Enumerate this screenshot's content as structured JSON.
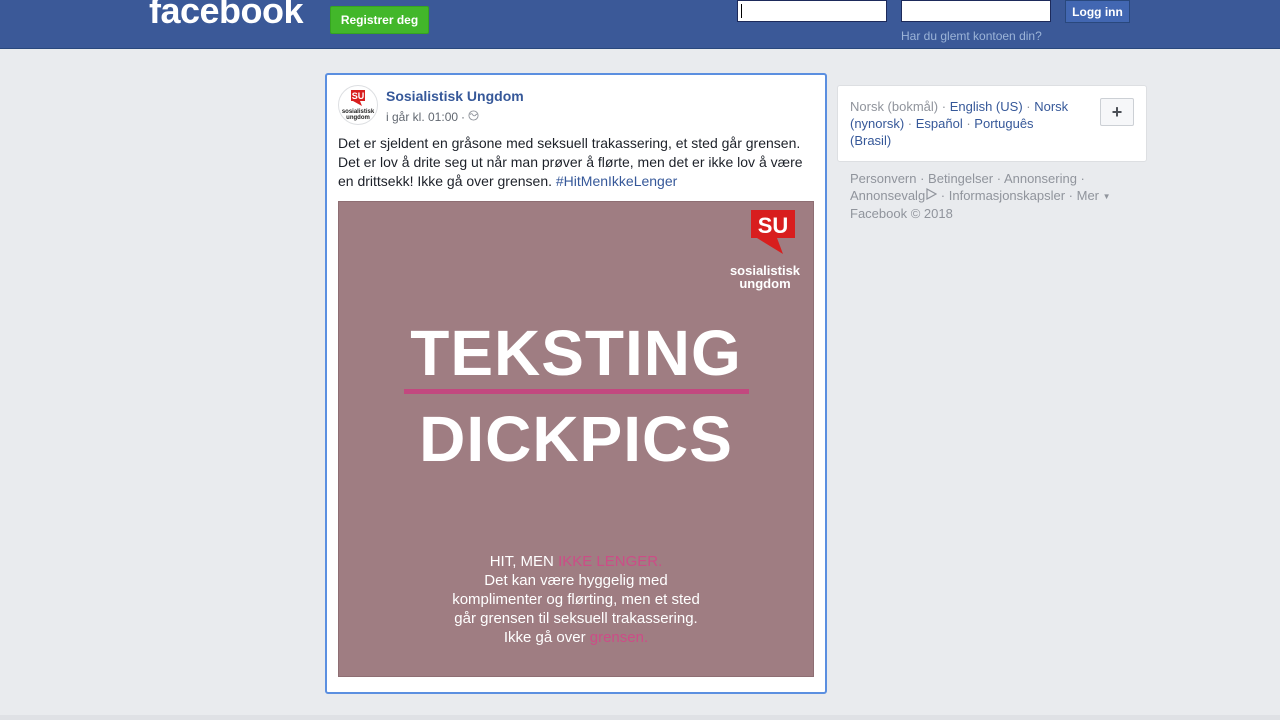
{
  "header": {
    "logo": "facebook",
    "register_label": "Registrer deg",
    "email_value": "",
    "password_value": "",
    "login_label": "Logg inn",
    "forgot_label": "Har du glemt kontoen din?"
  },
  "post": {
    "author": "Sosialistisk Ungdom",
    "timestamp": "i går kl. 01:00",
    "separator": "·",
    "text": "Det er sjeldent en gråsone med seksuell trakassering, et sted går grensen. Det er lov å drite seg ut når man prøver å flørte, men det er ikke lov å være en drittsekk! Ikke gå over grensen. ",
    "hashtag": "#HitMenIkkeLenger",
    "image": {
      "logo_letters": "SU",
      "logo_word1": "sosialistisk",
      "logo_word2": "ungdom",
      "title_line1": "TEKSTING",
      "title_line2": "DICKPICS",
      "caption_line1_a": "HIT, MEN ",
      "caption_line1_b": "IKKE LENGER.",
      "caption_line2": "Det kan være hyggelig med",
      "caption_line3": "komplimenter og flørting, men et sted",
      "caption_line4": "går grensen til seksuell trakassering.",
      "caption_line5_a": "Ikke gå over ",
      "caption_line5_b": "grensen.",
      "background_color": "#9f7d82",
      "accent_color": "#c2487f"
    }
  },
  "languages": {
    "current": "Norsk (bokmål)",
    "options": [
      "English (US)",
      "Norsk (nynorsk)",
      "Español",
      "Português (Brasil)"
    ],
    "add_label": "+"
  },
  "footer": {
    "links": [
      "Personvern",
      "Betingelser",
      "Annonsering",
      "Annonsevalg",
      "Informasjonskapsler",
      "Mer"
    ],
    "copyright": "Facebook © 2018"
  },
  "colors": {
    "brand": "#3b5998",
    "register": "#42b72a",
    "link": "#365899"
  }
}
